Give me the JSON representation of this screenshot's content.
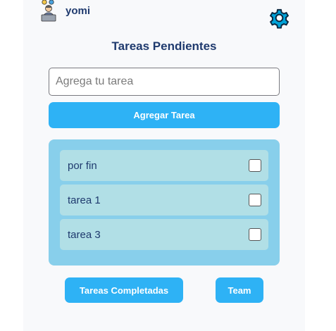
{
  "header": {
    "username": "yomi",
    "avatar_icon": "developer-avatar-icon",
    "settings_icon": "gear-icon"
  },
  "main": {
    "title": "Tareas Pendientes",
    "input_placeholder": "Agrega tu tarea",
    "add_button": "Agregar Tarea",
    "tasks": [
      {
        "label": "por fin",
        "checked": false
      },
      {
        "label": "tarea 1",
        "checked": false
      },
      {
        "label": "tarea 3",
        "checked": false
      }
    ]
  },
  "footer": {
    "completed_button": "Tareas Completadas",
    "team_button": "Team"
  },
  "colors": {
    "accent": "#2eb2f5",
    "list_bg": "#88cfeb",
    "item_bg": "#b1dfe6",
    "text": "#1f3a6e"
  }
}
